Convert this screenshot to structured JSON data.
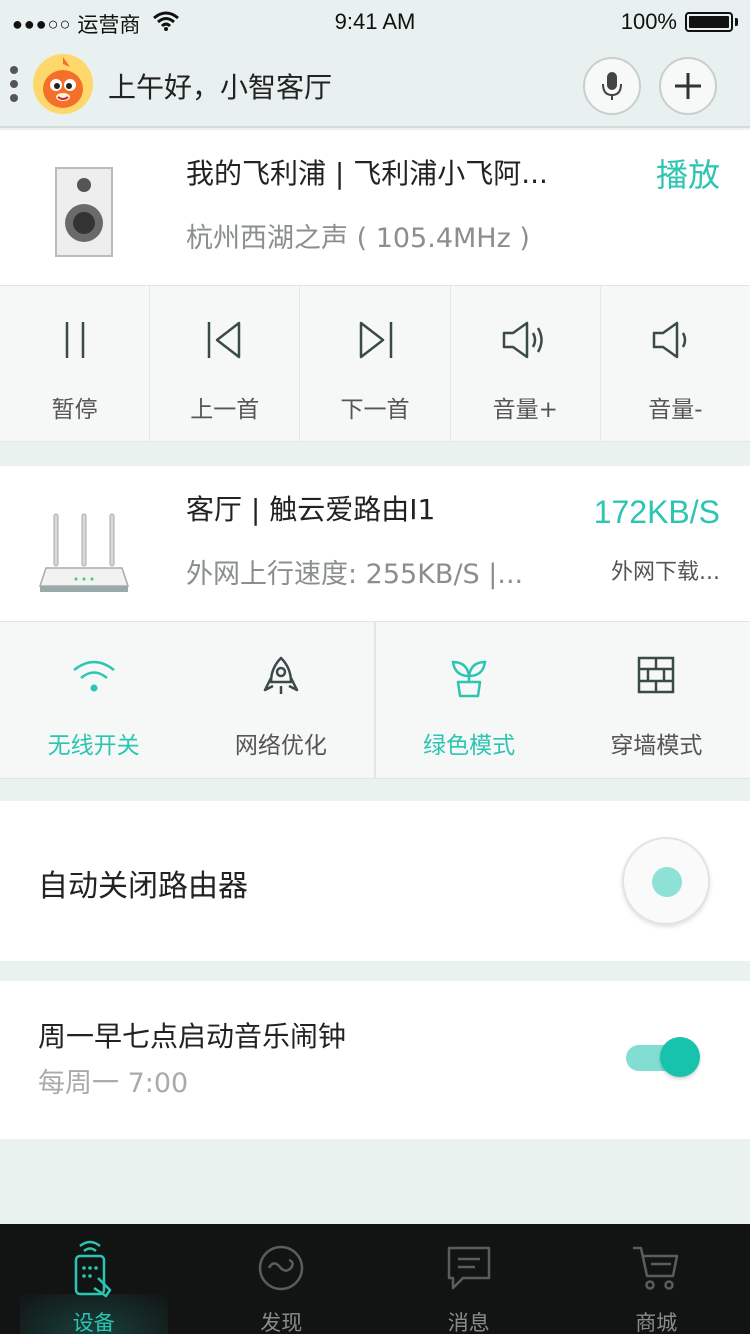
{
  "status_bar": {
    "signal": "●●●○○",
    "carrier": "运营商",
    "time": "9:41 AM",
    "battery": "100%"
  },
  "header": {
    "greeting": "上午好，小智客厅",
    "mic_icon": "mic-icon",
    "add_icon": "plus-icon"
  },
  "speaker": {
    "title": "我的飞利浦 | 飞利浦小飞阿...",
    "subtitle": "杭州西湖之声 ( 105.4MHz )",
    "action": "播放",
    "controls": [
      {
        "label": "暂停",
        "icon": "pause-icon"
      },
      {
        "label": "上一首",
        "icon": "previous-icon"
      },
      {
        "label": "下一首",
        "icon": "next-icon"
      },
      {
        "label": "音量+",
        "icon": "volume-up-icon"
      },
      {
        "label": "音量-",
        "icon": "volume-down-icon"
      }
    ]
  },
  "router": {
    "title": "客厅 | 触云爱路由I1",
    "subtitle": "外网上行速度: 255KB/S |...",
    "speed": "172KB/S",
    "speed_label": "外网下载...",
    "controls": [
      {
        "label": "无线开关",
        "icon": "wifi-icon",
        "active": true
      },
      {
        "label": "网络优化",
        "icon": "rocket-icon",
        "active": false
      },
      {
        "label": "绿色模式",
        "icon": "plant-icon",
        "active": true
      },
      {
        "label": "穿墙模式",
        "icon": "wall-icon",
        "active": false
      }
    ]
  },
  "auto_close": {
    "label": "自动关闭路由器"
  },
  "alarm": {
    "title": "周一早七点启动音乐闹钟",
    "subtitle": "每周一 7:00",
    "enabled": true
  },
  "tabs": [
    {
      "label": "设备",
      "icon": "remote-icon",
      "active": true
    },
    {
      "label": "发现",
      "icon": "discover-icon",
      "active": false
    },
    {
      "label": "消息",
      "icon": "message-icon",
      "active": false
    },
    {
      "label": "商城",
      "icon": "cart-icon",
      "active": false
    }
  ],
  "colors": {
    "accent": "#2cc5b1",
    "background": "#eaf2f0",
    "tabbar": "#121414"
  }
}
